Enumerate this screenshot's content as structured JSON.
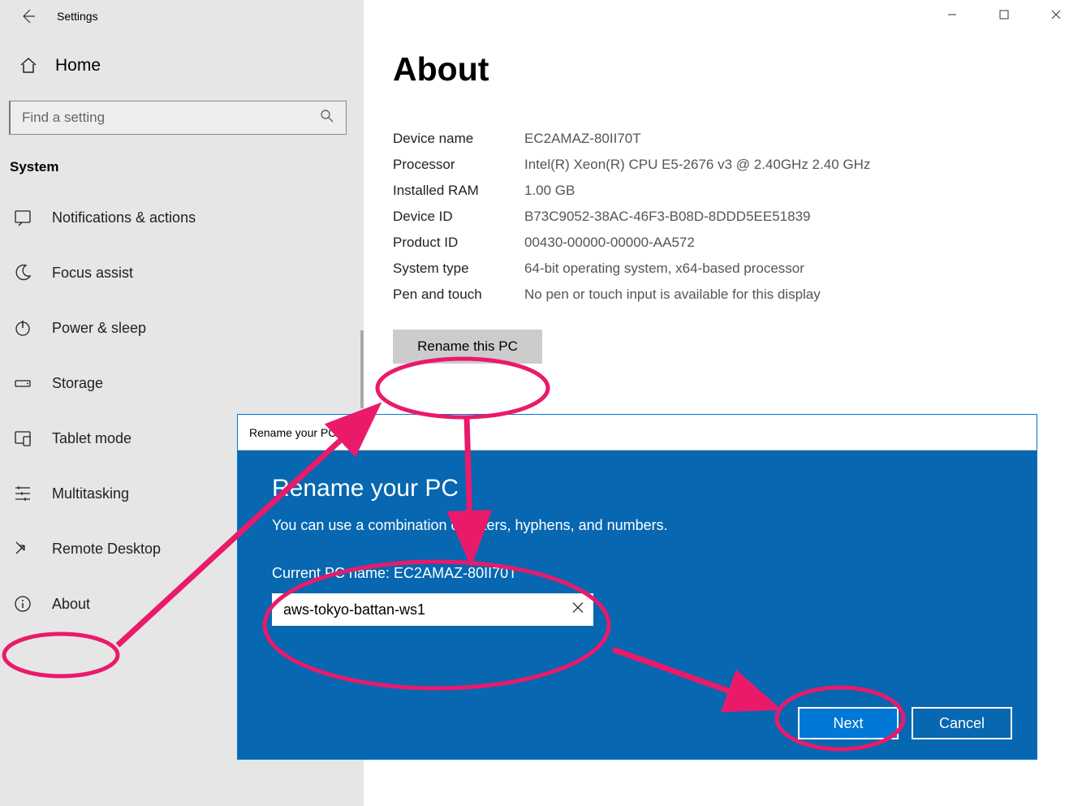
{
  "app_title": "Settings",
  "home_label": "Home",
  "search_placeholder": "Find a setting",
  "section_label": "System",
  "nav_items": [
    {
      "label": "Notifications & actions"
    },
    {
      "label": "Focus assist"
    },
    {
      "label": "Power & sleep"
    },
    {
      "label": "Storage"
    },
    {
      "label": "Tablet mode"
    },
    {
      "label": "Multitasking"
    },
    {
      "label": "Remote Desktop"
    },
    {
      "label": "About"
    }
  ],
  "page_title": "About",
  "specs": [
    {
      "label": "Device name",
      "value": "EC2AMAZ-80II70T"
    },
    {
      "label": "Processor",
      "value": "Intel(R) Xeon(R) CPU E5-2676 v3 @ 2.40GHz   2.40 GHz"
    },
    {
      "label": "Installed RAM",
      "value": "1.00 GB"
    },
    {
      "label": "Device ID",
      "value": "B73C9052-38AC-46F3-B08D-8DDD5EE51839"
    },
    {
      "label": "Product ID",
      "value": "00430-00000-00000-AA572"
    },
    {
      "label": "System type",
      "value": "64-bit operating system, x64-based processor"
    },
    {
      "label": "Pen and touch",
      "value": "No pen or touch input is available for this display"
    }
  ],
  "rename_button": "Rename this PC",
  "dialog": {
    "titlebar": "Rename your PC",
    "heading": "Rename your PC",
    "desc": "You can use a combination of letters, hyphens, and numbers.",
    "current_label": "Current PC name: EC2AMAZ-80II70T",
    "input_value": "aws-tokyo-battan-ws1",
    "next": "Next",
    "cancel": "Cancel"
  }
}
